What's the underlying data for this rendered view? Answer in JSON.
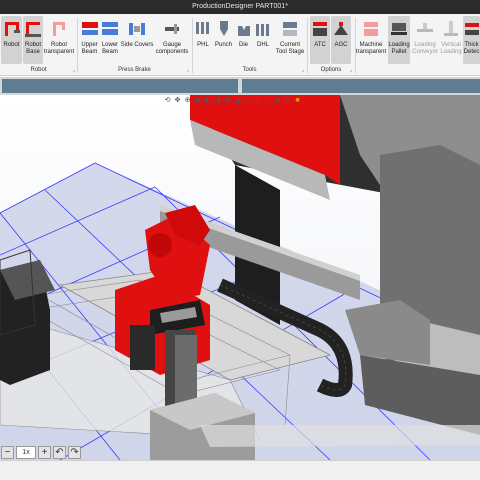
{
  "window": {
    "title": "ProductionDesigner  PART001*"
  },
  "ribbon": {
    "buttons": [
      {
        "label": "Robot",
        "icon": "robot-icon"
      },
      {
        "label": "Robot\nBase",
        "icon": "robot-base-icon"
      },
      {
        "label": "Robot\ntransparent",
        "icon": "robot-transparent-icon"
      },
      {
        "label": "Upper\nBeam",
        "icon": "upper-beam-icon"
      },
      {
        "label": "Lower\nBeam",
        "icon": "lower-beam-icon"
      },
      {
        "label": "Side Covers",
        "icon": "side-covers-icon"
      },
      {
        "label": "Gauge\ncomponents",
        "icon": "gauge-components-icon"
      },
      {
        "label": "PHL",
        "icon": "phl-icon"
      },
      {
        "label": "Punch",
        "icon": "punch-icon"
      },
      {
        "label": "Die",
        "icon": "die-icon"
      },
      {
        "label": "DHL",
        "icon": "dhl-icon"
      },
      {
        "label": "Current\nTool Stage",
        "icon": "tool-stage-icon"
      },
      {
        "label": "ATC",
        "icon": "atc-icon"
      },
      {
        "label": "AGC",
        "icon": "agc-icon"
      },
      {
        "label": "Machine\ntransparent",
        "icon": "machine-transparent-icon"
      },
      {
        "label": "Loading\nPallet",
        "icon": "loading-pallet-icon"
      },
      {
        "label": "Loading\nConveyor",
        "icon": "loading-conveyor-icon"
      },
      {
        "label": "Vertical\nLoading",
        "icon": "vertical-loading-icon"
      },
      {
        "label": "Thick\nDetec",
        "icon": "thickness-detection-icon"
      }
    ],
    "groups": {
      "robot": "Robot",
      "press_brake": "Press Brake",
      "tools": "Tools",
      "options": "Options"
    }
  },
  "viewport": {
    "colors": {
      "robot": "#e01010",
      "machine": "#3a3a3a",
      "grid": "#3a3aff",
      "floor": "#c0c6e2"
    }
  },
  "bottombar": {
    "minus": "−",
    "speed": "1x",
    "plus": "+"
  }
}
